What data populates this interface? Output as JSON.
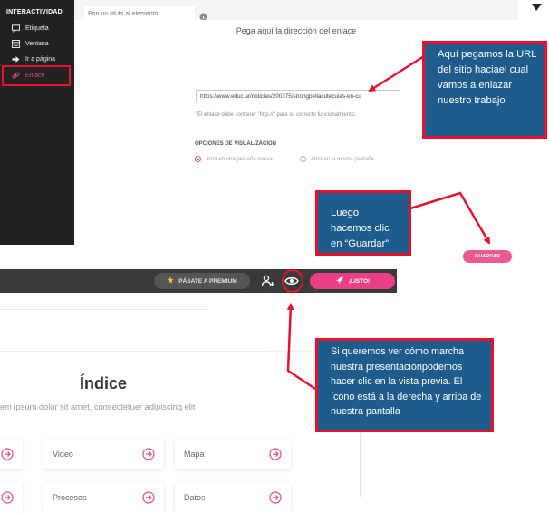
{
  "sidebar": {
    "heading": "INTERACTIVIDAD",
    "items": [
      {
        "label": "Etiqueta",
        "icon": "speech-bubble-icon"
      },
      {
        "label": "Ventana",
        "icon": "window-icon"
      },
      {
        "label": "Ir a página",
        "icon": "arrow-right-icon"
      },
      {
        "label": "Enlace",
        "icon": "link-icon",
        "active": true
      }
    ]
  },
  "editor": {
    "title_placeholder": "Pon un título al elemento",
    "modal_title": "Pega aquí la dirección del enlace",
    "url_value": "https://www.educ.ar/noticias/200375/strongpeliacutecuias-en-cu",
    "url_help": "\"El enlace debe contener \"http://\" para su correcto funcionamiento.",
    "options_heading": "OPCIONES DE VISUALIZACIÓN",
    "options": [
      {
        "label": "Abrir en una pestaña nueva",
        "selected": true
      },
      {
        "label": "Abrir en la misma pestaña",
        "selected": false
      }
    ],
    "save_button": "GUARDAR"
  },
  "toolbar": {
    "premium_label": "PÁSATE A PREMIUM",
    "ready_label": "¡LISTO!"
  },
  "preview": {
    "title": "Índice",
    "subtitle": "em ipsum dolor sit amet, consectetuer adipiscing elit",
    "cards": [
      "Video",
      "Mapa",
      "Procesos",
      "Datos"
    ]
  },
  "callouts": {
    "url": "Aquí pegamos la URL del sitio haciael cual vamos a enlazar nuestro trabajo",
    "save": "Luego hacemos clic en “Guardar”",
    "preview": "Si queremos ver cómo marcha nuestra presentaciónpodemos hacer clic en la vista previa. El ícono está a la derecha y arriba de nuestra pantalla"
  },
  "colors": {
    "sidebar_bg": "#222222",
    "accent_pink": "#ea3e87",
    "callout_bg": "#1e5c8e",
    "annotation_red": "#e8112d",
    "toolbar_bg": "#3a3a3a"
  }
}
